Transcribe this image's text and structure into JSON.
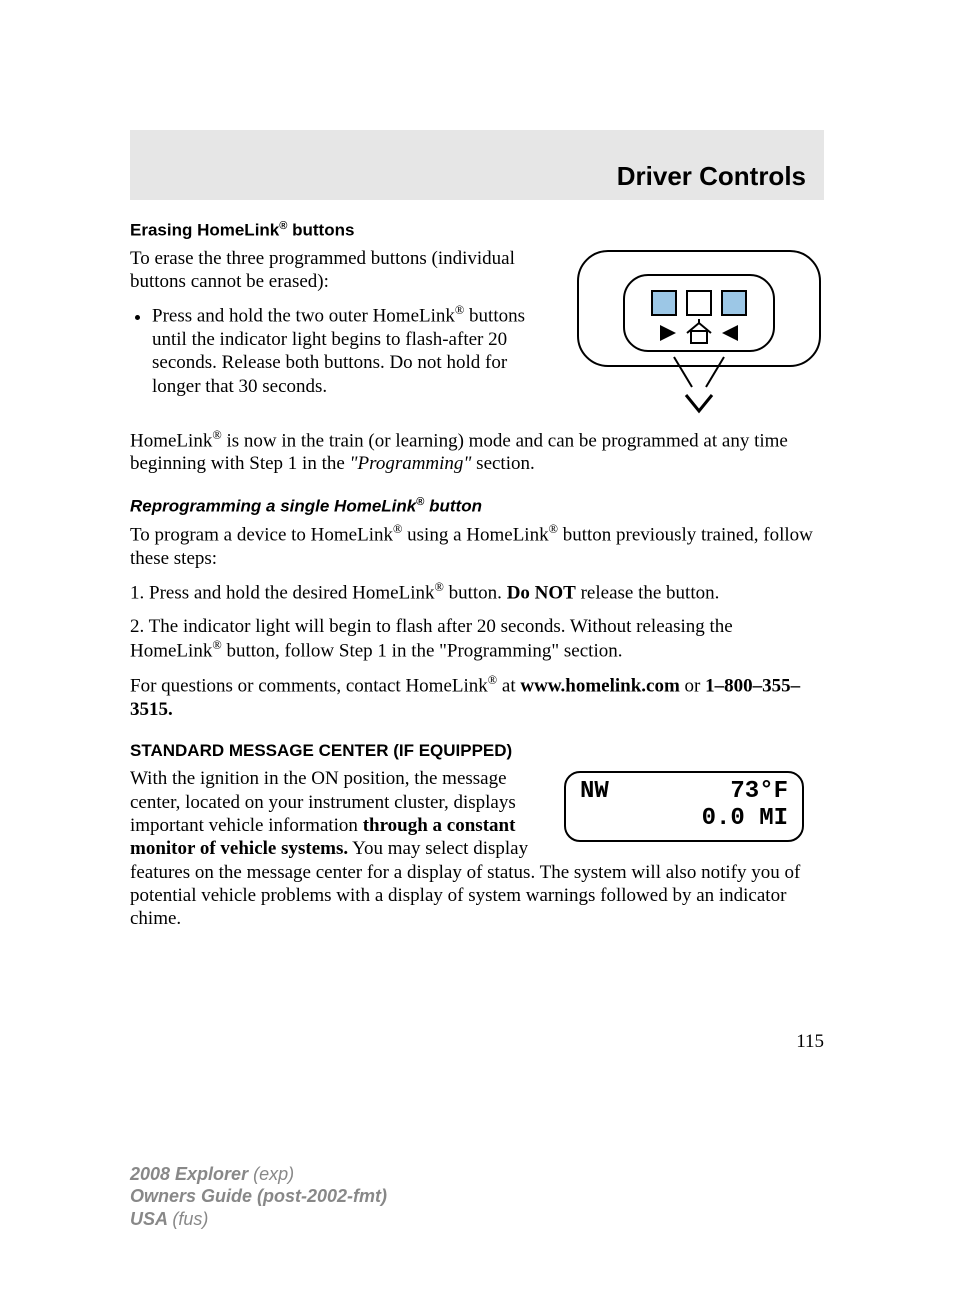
{
  "header": {
    "title": "Driver Controls"
  },
  "section1": {
    "heading_pre": "Erasing HomeLink",
    "heading_post": " buttons",
    "p1": "To erase the three programmed buttons (individual buttons cannot be erased):",
    "bullet_pre": "Press and hold the two outer HomeLink",
    "bullet_post": " buttons until the indicator light begins to flash-after 20 seconds. Release both buttons. Do not hold for longer that 30 seconds.",
    "p2_pre": "HomeLink",
    "p2_mid": " is now in the train (or learning) mode and can be programmed at any time beginning with Step 1 in the ",
    "p2_ital": "\"Programming\"",
    "p2_post": " section."
  },
  "section2": {
    "heading_pre": "Reprogramming a single HomeLink",
    "heading_post": " button",
    "p1_pre": "To program a device to HomeLink",
    "p1_mid": " using a HomeLink",
    "p1_post": " button previously trained, follow these steps:",
    "p2_pre": "1. Press and hold the desired HomeLink",
    "p2_mid": " button. ",
    "p2_bold": "Do NOT",
    "p2_post": " release the button.",
    "p3_pre": "2. The indicator light will begin to flash after 20 seconds. Without releasing the HomeLink",
    "p3_post": " button, follow Step 1 in the \"Programming\" section.",
    "p4_pre": "For questions or comments, contact HomeLink",
    "p4_mid": " at ",
    "p4_url": "www.homelink.com",
    "p4_or": " or ",
    "p4_phone": "1–800–355–3515."
  },
  "section3": {
    "heading": "STANDARD MESSAGE CENTER (IF EQUIPPED)",
    "p1_pre": "With the ignition in the ON position, the message center, located on your instrument cluster, displays important vehicle information ",
    "p1_bold": "through a constant monitor of vehicle systems.",
    "p1_post": " You may select display features on the message center for a display of status. The system will also notify you of potential vehicle problems with a display of system warnings followed by an indicator chime."
  },
  "display": {
    "compass": "NW",
    "temp": "73°F",
    "mileage": "0.0 MI"
  },
  "page_number": "115",
  "footer": {
    "l1a": "2008 Explorer ",
    "l1b": "(exp)",
    "l2": "Owners Guide (post-2002-fmt)",
    "l3a": "USA ",
    "l3b": "(fus)"
  },
  "reg": "®"
}
